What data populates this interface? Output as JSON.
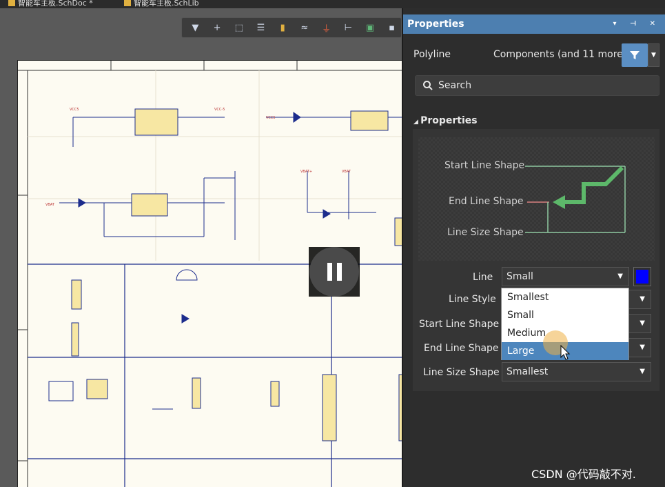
{
  "tabs": [
    {
      "label": "智能车主板.SchDoc *"
    },
    {
      "label": "智能车主板.SchLib"
    }
  ],
  "toolbar": {
    "icons": [
      "filter-icon",
      "plus-icon",
      "select-rect-icon",
      "align-icon",
      "component-icon",
      "wire-icon",
      "power-icon",
      "bus-icon",
      "place-icon",
      "more-icon"
    ]
  },
  "panel": {
    "title": "Properties",
    "object_type": "Polyline",
    "filter_label": "Components (and 11 more)",
    "search_placeholder": "Search",
    "section_title": "Properties",
    "preview": {
      "start_label": "Start Line Shape",
      "end_label": "End Line Shape",
      "size_label": "Line Size Shape"
    },
    "fields": {
      "line_label": "Line",
      "line_value": "Small",
      "line_color": "#0000ff",
      "style_label": "Line Style",
      "start_label": "Start Line Shape",
      "end_label": "End Line Shape",
      "size_label": "Line Size Shape",
      "size_value": "Smallest"
    },
    "dropdown_options": [
      "Smallest",
      "Small",
      "Medium",
      "Large"
    ],
    "dropdown_selected": "Large"
  },
  "watermark": "CSDN @代码敲不对."
}
